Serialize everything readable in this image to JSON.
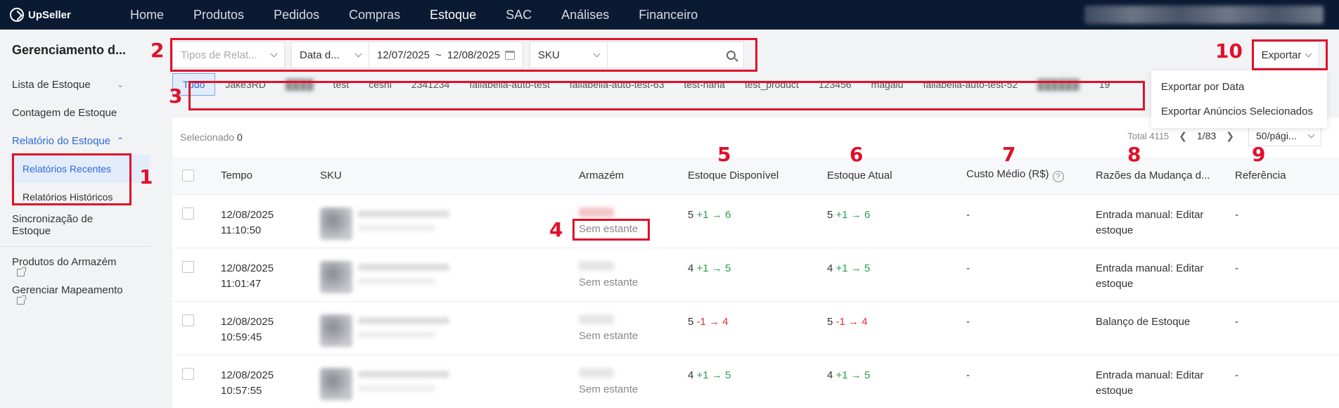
{
  "app": {
    "logo_text": "UpSeller"
  },
  "nav": [
    "Home",
    "Produtos",
    "Pedidos",
    "Compras",
    "Estoque",
    "SAC",
    "Análises",
    "Financeiro"
  ],
  "nav_active": "Estoque",
  "sidebar": {
    "title": "Gerenciamento d...",
    "items": {
      "lista": "Lista de Estoque",
      "contagem": "Contagem de Estoque",
      "relatorio": "Relatório do Estoque",
      "recentes": "Relatórios Recentes",
      "historicos": "Relatórios Históricos",
      "sincronizacao": "Sincronização de Estoque",
      "produtos": "Produtos do Armazém",
      "mapeamento": "Gerenciar Mapeamento"
    }
  },
  "filters": {
    "report_type_placeholder": "Tipos de Relat...",
    "date_type": "Data d...",
    "date_start": "12/07/2025",
    "date_sep": "~",
    "date_end": "12/08/2025",
    "search_field": "SKU"
  },
  "export": {
    "label": "Exportar",
    "options": [
      "Exportar por Data",
      "Exportar Anúncios Selecionados"
    ]
  },
  "tabs": [
    "Tudo",
    "Jake3RD",
    "",
    "test",
    "ceshi",
    "2341234",
    "fallabella-auto-test",
    "fallabella-auto-test-63",
    "test-haha",
    "test_product",
    "123456",
    "magalu",
    "fallabella-auto-test-52",
    "",
    "19"
  ],
  "selection": {
    "label": "Selecionado",
    "count": "0"
  },
  "pager": {
    "total": "Total 4115",
    "page": "1/83",
    "per_page": "50/pági..."
  },
  "columns": {
    "tempo": "Tempo",
    "sku": "SKU",
    "armazem": "Armazém",
    "disponivel": "Estoque Disponível",
    "atual": "Estoque Atual",
    "custo": "Custo Médio (R$)",
    "razoes": "Razões da Mudança d...",
    "referencia": "Referência"
  },
  "rows": [
    {
      "date": "12/08/2025",
      "time": "11:10:50",
      "shelf": "Sem estante",
      "disp_base": "5",
      "disp_change": "+1 → 6",
      "atual_base": "5",
      "atual_change": "+1 → 6",
      "change_type": "green",
      "custo": "-",
      "razao": "Entrada manual: Editar estoque",
      "ref": "-"
    },
    {
      "date": "12/08/2025",
      "time": "11:01:47",
      "shelf": "Sem estante",
      "disp_base": "4",
      "disp_change": "+1 → 5",
      "atual_base": "4",
      "atual_change": "+1 → 5",
      "change_type": "green",
      "custo": "-",
      "razao": "Entrada manual: Editar estoque",
      "ref": "-"
    },
    {
      "date": "12/08/2025",
      "time": "10:59:45",
      "shelf": "Sem estante",
      "disp_base": "5",
      "disp_change": "-1 → 4",
      "atual_base": "5",
      "atual_change": "-1 → 4",
      "change_type": "red",
      "custo": "-",
      "razao": "Balanço de Estoque",
      "ref": "-"
    },
    {
      "date": "12/08/2025",
      "time": "10:57:55",
      "shelf": "Sem estante",
      "disp_base": "4",
      "disp_change": "+1 → 5",
      "atual_base": "4",
      "atual_change": "+1 → 5",
      "change_type": "green",
      "custo": "-",
      "razao": "Entrada manual: Editar estoque",
      "ref": "-"
    }
  ],
  "annotations": [
    "1",
    "2",
    "3",
    "4",
    "5",
    "6",
    "7",
    "8",
    "9",
    "10"
  ],
  "colors": {
    "accent": "#2c6bd9",
    "annotation": "#e0102a",
    "increase": "#2aa04a",
    "decrease": "#e03030",
    "topbar": "#0b1a33"
  }
}
